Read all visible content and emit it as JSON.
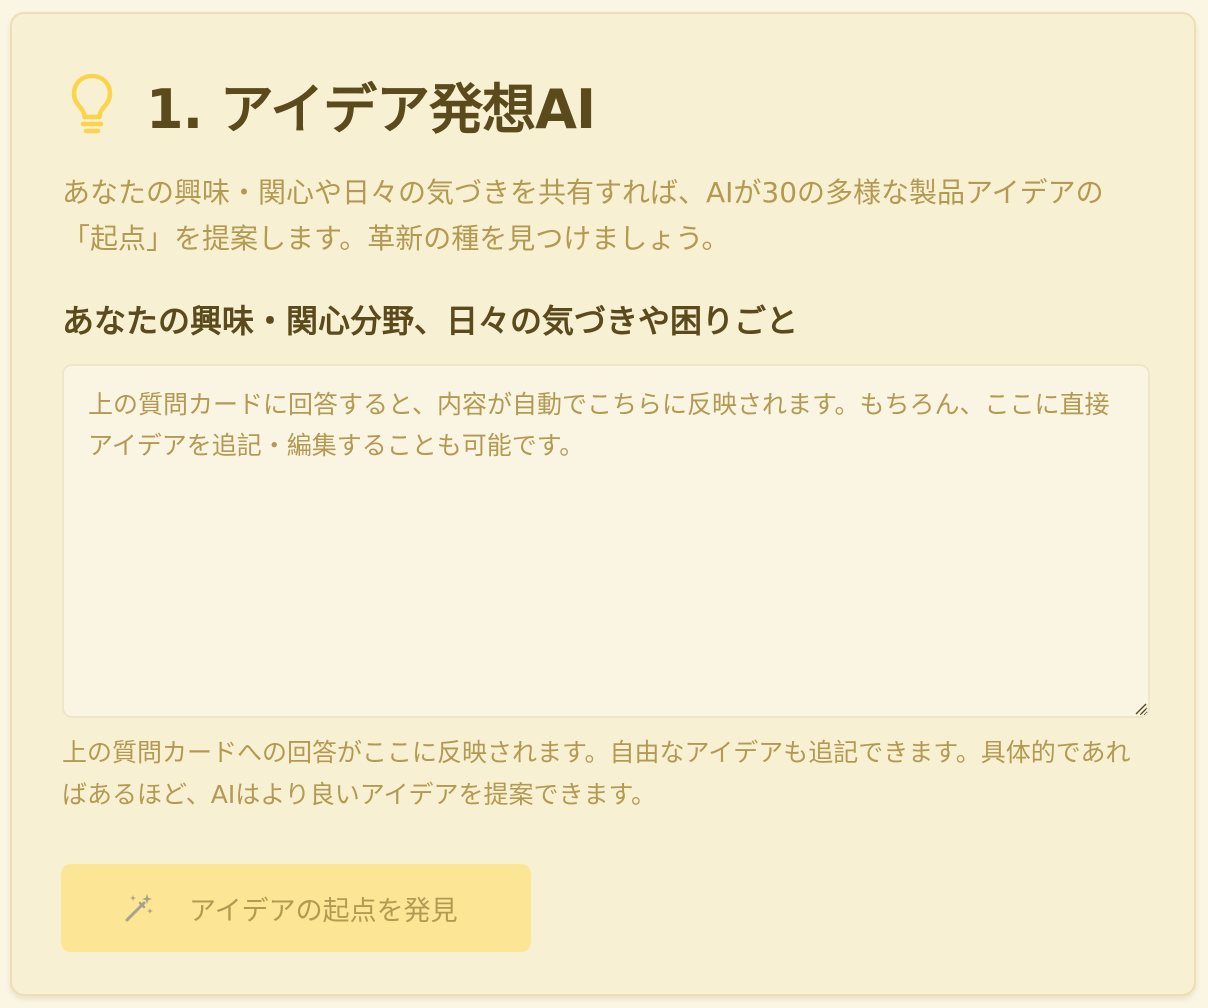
{
  "section": {
    "icon": "lightbulb-icon",
    "title": "1. アイデア発想AI",
    "description": "あなたの興味・関心や日々の気づきを共有すれば、AIが30の多様な製品アイデアの「起点」を提案します。革新の種を見つけましょう。"
  },
  "form": {
    "label": "あなたの興味・関心分野、日々の気づきや困りごと",
    "textarea_value": "",
    "textarea_placeholder": "上の質問カードに回答すると、内容が自動でこちらに反映されます。もちろん、ここに直接アイデアを追記・編集することも可能です。",
    "helper_text": "上の質問カードへの回答がここに反映されます。自由なアイデアも追記できます。具体的であればあるほど、AIはより良いアイデアを提案できます。"
  },
  "action": {
    "icon": "magic-wand-icon",
    "button_label": "アイデアの起点を発見",
    "disabled": true
  },
  "colors": {
    "card_background": "#f8f0d2",
    "title_text": "#5b4a1c",
    "muted_text": "#b39a52",
    "bulb_icon": "#fcd34d",
    "button_background": "#fce595"
  }
}
